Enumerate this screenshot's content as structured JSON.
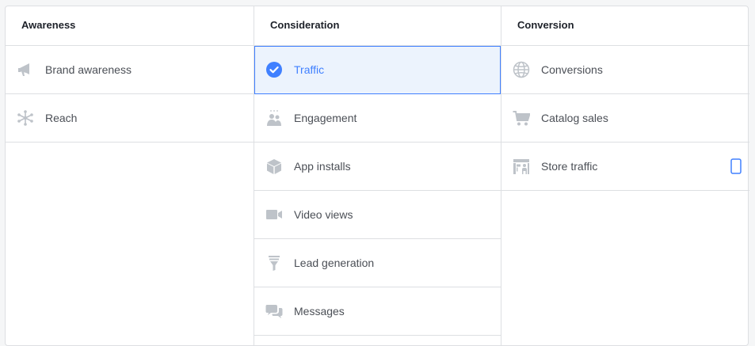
{
  "columns": [
    {
      "header": "Awareness",
      "items": [
        {
          "label": "Brand awareness",
          "icon": "megaphone-icon"
        },
        {
          "label": "Reach",
          "icon": "reach-icon"
        }
      ]
    },
    {
      "header": "Consideration",
      "items": [
        {
          "label": "Traffic",
          "icon": "checkmark-circle-icon",
          "selected": true
        },
        {
          "label": "Engagement",
          "icon": "people-icon"
        },
        {
          "label": "App installs",
          "icon": "box-icon"
        },
        {
          "label": "Video views",
          "icon": "video-camera-icon"
        },
        {
          "label": "Lead generation",
          "icon": "funnel-icon"
        },
        {
          "label": "Messages",
          "icon": "chat-bubbles-icon"
        }
      ]
    },
    {
      "header": "Conversion",
      "items": [
        {
          "label": "Conversions",
          "icon": "globe-icon"
        },
        {
          "label": "Catalog sales",
          "icon": "shopping-cart-icon"
        },
        {
          "label": "Store traffic",
          "icon": "storefront-icon",
          "side_icon": "mobile-device-icon"
        }
      ]
    }
  ],
  "colors": {
    "selected_text": "#4080ff",
    "selected_bg": "#ecf3fd",
    "icon_gray": "#bec3c9",
    "text": "#4b4f56",
    "header_text": "#1d2129",
    "border": "#dddfe2"
  }
}
